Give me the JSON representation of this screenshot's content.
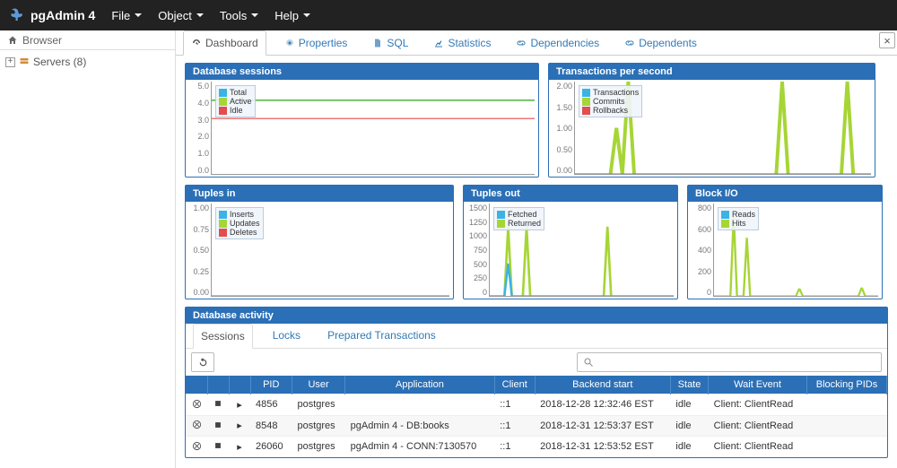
{
  "app_title": "pgAdmin 4",
  "top_menu": {
    "file": "File",
    "object": "Object",
    "tools": "Tools",
    "help": "Help"
  },
  "browser": {
    "title": "Browser",
    "root": "Servers (8)"
  },
  "tabs": {
    "dashboard": "Dashboard",
    "properties": "Properties",
    "sql": "SQL",
    "statistics": "Statistics",
    "dependencies": "Dependencies",
    "dependents": "Dependents"
  },
  "panels": {
    "sessions": {
      "title": "Database sessions",
      "legend": [
        "Total",
        "Active",
        "Idle"
      ],
      "yticks": [
        "5.0",
        "4.0",
        "3.0",
        "2.0",
        "1.0",
        "0.0"
      ]
    },
    "tps": {
      "title": "Transactions per second",
      "legend": [
        "Transactions",
        "Commits",
        "Rollbacks"
      ],
      "yticks": [
        "2.00",
        "1.50",
        "1.00",
        "0.50",
        "0.00"
      ]
    },
    "tuples_in": {
      "title": "Tuples in",
      "legend": [
        "Inserts",
        "Updates",
        "Deletes"
      ],
      "yticks": [
        "1.00",
        "0.75",
        "0.50",
        "0.25",
        "0.00"
      ]
    },
    "tuples_out": {
      "title": "Tuples out",
      "legend": [
        "Fetched",
        "Returned"
      ],
      "yticks": [
        "1500",
        "1250",
        "1000",
        "750",
        "500",
        "250",
        "0"
      ]
    },
    "block_io": {
      "title": "Block I/O",
      "legend": [
        "Reads",
        "Hits"
      ],
      "yticks": [
        "800",
        "600",
        "400",
        "200",
        "0"
      ]
    }
  },
  "activity": {
    "title": "Database activity",
    "subtabs": {
      "sessions": "Sessions",
      "locks": "Locks",
      "prepared": "Prepared Transactions"
    },
    "columns": [
      "",
      "",
      "",
      "PID",
      "User",
      "Application",
      "Client",
      "Backend start",
      "State",
      "Wait Event",
      "Blocking PIDs"
    ],
    "rows": [
      {
        "pid": "4856",
        "user": "postgres",
        "app": "",
        "client": "::1",
        "start": "2018-12-28 12:32:46 EST",
        "state": "idle",
        "wait": "Client: ClientRead",
        "blocking": ""
      },
      {
        "pid": "8548",
        "user": "postgres",
        "app": "pgAdmin 4 - DB:books",
        "client": "::1",
        "start": "2018-12-31 12:53:37 EST",
        "state": "idle",
        "wait": "Client: ClientRead",
        "blocking": ""
      },
      {
        "pid": "26060",
        "user": "postgres",
        "app": "pgAdmin 4 - CONN:7130570",
        "client": "::1",
        "start": "2018-12-31 12:53:52 EST",
        "state": "idle",
        "wait": "Client: ClientRead",
        "blocking": ""
      }
    ]
  },
  "chart_data": [
    {
      "type": "line",
      "title": "Database sessions",
      "ylim": [
        0,
        5
      ],
      "series": [
        {
          "name": "Total",
          "color": "#3bb3e4",
          "values": [
            4,
            4,
            4,
            4,
            4,
            4,
            4,
            4,
            4,
            4,
            4,
            4,
            4,
            4,
            4,
            4
          ]
        },
        {
          "name": "Active",
          "color": "#a6d536",
          "values": [
            4,
            4,
            4,
            4,
            4,
            4,
            4,
            4,
            4,
            4,
            4,
            4,
            4,
            4,
            4,
            4
          ]
        },
        {
          "name": "Idle",
          "color": "#e34d4d",
          "values": [
            3,
            3,
            3,
            3,
            3,
            3,
            3,
            3,
            3,
            3,
            3,
            3,
            3,
            3,
            3,
            3
          ]
        }
      ]
    },
    {
      "type": "line",
      "title": "Transactions per second",
      "ylim": [
        0,
        2
      ],
      "series": [
        {
          "name": "Transactions",
          "color": "#3bb3e4",
          "values": [
            0,
            0,
            0,
            0,
            0,
            0,
            0,
            0,
            0,
            0,
            0,
            0,
            0,
            0,
            0,
            0
          ]
        },
        {
          "name": "Commits",
          "color": "#a6d536",
          "values": [
            0,
            0,
            1,
            2,
            0,
            0,
            0,
            0,
            0,
            0,
            0,
            2,
            0,
            0,
            2,
            0
          ]
        },
        {
          "name": "Rollbacks",
          "color": "#e34d4d",
          "values": [
            0,
            0,
            0,
            0,
            0,
            0,
            0,
            0,
            0,
            0,
            0,
            0,
            0,
            0,
            0,
            0
          ]
        }
      ]
    },
    {
      "type": "line",
      "title": "Tuples in",
      "ylim": [
        0,
        1
      ],
      "series": [
        {
          "name": "Inserts",
          "color": "#3bb3e4",
          "values": [
            0,
            0,
            0,
            0,
            0,
            0,
            0,
            0,
            0,
            0,
            0,
            0,
            0,
            0,
            0,
            0
          ]
        },
        {
          "name": "Updates",
          "color": "#a6d536",
          "values": [
            0,
            0,
            0,
            0,
            0,
            0,
            0,
            0,
            0,
            0,
            0,
            0,
            0,
            0,
            0,
            0
          ]
        },
        {
          "name": "Deletes",
          "color": "#e34d4d",
          "values": [
            0,
            0,
            0,
            0,
            0,
            0,
            0,
            0,
            0,
            0,
            0,
            0,
            0,
            0,
            0,
            0
          ]
        }
      ]
    },
    {
      "type": "line",
      "title": "Tuples out",
      "ylim": [
        0,
        1500
      ],
      "series": [
        {
          "name": "Fetched",
          "color": "#3bb3e4",
          "values": [
            0,
            0,
            500,
            0,
            0,
            0,
            0,
            0,
            0,
            0,
            0,
            0,
            0,
            0,
            0,
            0
          ]
        },
        {
          "name": "Returned",
          "color": "#a6d536",
          "values": [
            0,
            0,
            1100,
            1100,
            0,
            0,
            0,
            0,
            0,
            0,
            1100,
            0,
            0,
            0,
            0,
            0
          ]
        }
      ]
    },
    {
      "type": "line",
      "title": "Block I/O",
      "ylim": [
        0,
        800
      ],
      "series": [
        {
          "name": "Reads",
          "color": "#3bb3e4",
          "values": [
            0,
            0,
            0,
            0,
            0,
            0,
            0,
            0,
            0,
            0,
            0,
            0,
            0,
            0,
            0,
            0
          ]
        },
        {
          "name": "Hits",
          "color": "#a6d536",
          "values": [
            0,
            0,
            700,
            500,
            0,
            0,
            0,
            0,
            60,
            0,
            0,
            0,
            0,
            0,
            70,
            0
          ]
        }
      ]
    }
  ]
}
